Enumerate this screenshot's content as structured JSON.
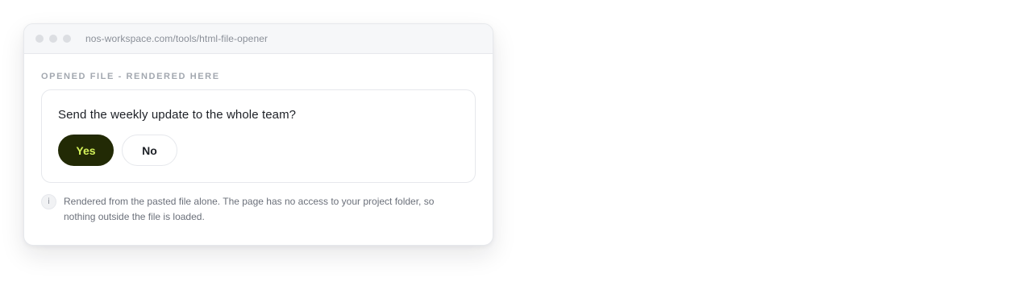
{
  "window": {
    "url": "nos-workspace.com/tools/html-file-opener"
  },
  "section": {
    "label": "OPENED FILE - RENDERED HERE"
  },
  "card": {
    "question": "Send the weekly update to the whole team?",
    "yes_label": "Yes",
    "no_label": "No"
  },
  "note": {
    "icon": "info-icon",
    "text": "Rendered from the pasted file alone. The page has no access to your project folder, so nothing outside the file is loaded."
  },
  "colors": {
    "yes_background": "#222a05",
    "yes_text": "#d4f25a"
  }
}
